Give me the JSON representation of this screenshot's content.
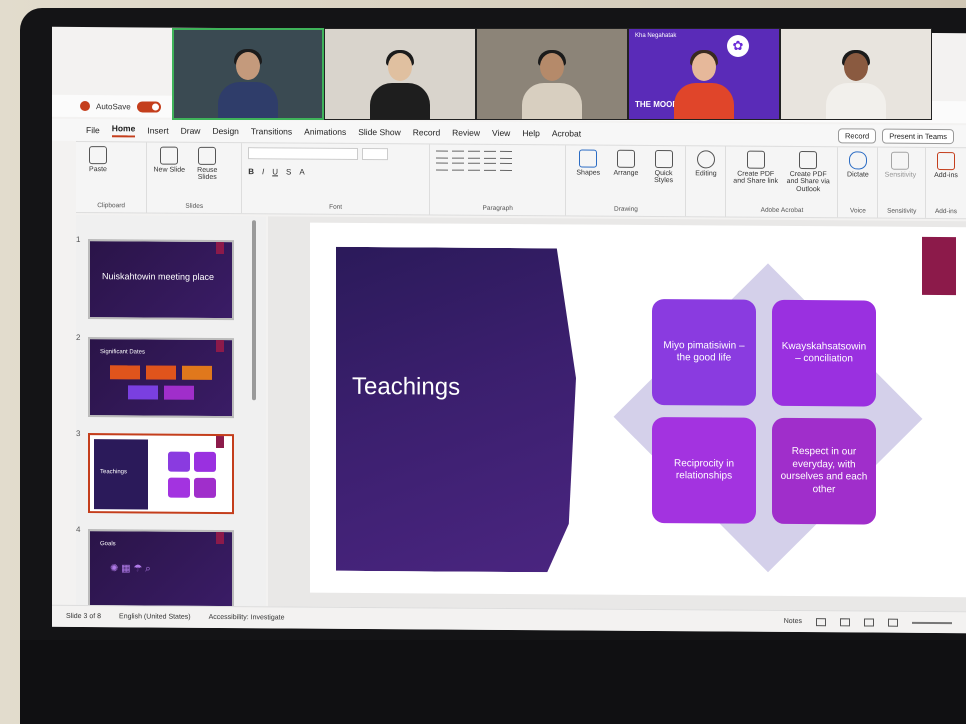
{
  "zoom": {
    "participant_name": "Kha Negahatak",
    "brand_tag": "THE MOODLE",
    "brand_logo_text": "MOODLE"
  },
  "titlebar": {
    "autosave_label": "AutoSave",
    "autosave_state": "On"
  },
  "tabs": [
    {
      "label": "File"
    },
    {
      "label": "Home"
    },
    {
      "label": "Insert"
    },
    {
      "label": "Draw"
    },
    {
      "label": "Design"
    },
    {
      "label": "Transitions"
    },
    {
      "label": "Animations"
    },
    {
      "label": "Slide Show"
    },
    {
      "label": "Record"
    },
    {
      "label": "Review"
    },
    {
      "label": "View"
    },
    {
      "label": "Help"
    },
    {
      "label": "Acrobat"
    }
  ],
  "tab_actions": {
    "record": "Record",
    "present": "Present in Teams"
  },
  "ribbon": {
    "paste": "Paste",
    "clipboard": "Clipboard",
    "new_slide": "New Slide",
    "reuse_slides": "Reuse Slides",
    "slides_group": "Slides",
    "font_group": "Font",
    "paragraph_group": "Paragraph",
    "shapes": "Shapes",
    "arrange": "Arrange",
    "quick_styles": "Quick Styles",
    "drawing_group": "Drawing",
    "editing": "Editing",
    "create_pdf_share": "Create PDF and Share link",
    "create_pdf_outlook": "Create PDF and Share via Outlook",
    "adobe_group": "Adobe Acrobat",
    "dictate": "Dictate",
    "voice_group": "Voice",
    "sensitivity": "Sensitivity",
    "sensitivity_group": "Sensitivity",
    "addins": "Add-ins",
    "addins_group": "Add-ins"
  },
  "thumbnails": [
    {
      "num": "1",
      "title": "Nuiskahtowin meeting place"
    },
    {
      "num": "2",
      "title": "Significant Dates"
    },
    {
      "num": "3",
      "title": "Teachings"
    },
    {
      "num": "4",
      "title": "Goals"
    }
  ],
  "slide": {
    "title": "Teachings",
    "boxes": [
      "Miyo pimatisiwin – the good life",
      "Kwayskahsatsowin – conciliation",
      "Reciprocity in relationships",
      "Respect in our everyday, with ourselves and each other"
    ]
  },
  "status": {
    "slide_count": "Slide 3 of 8",
    "language": "English (United States)",
    "accessibility": "Accessibility: Investigate",
    "notes": "Notes"
  },
  "colors": {
    "accent": "#c43e1c",
    "slide_dark": "#2b1a5a",
    "box_purple": "#8a3be0",
    "deco_rect": "#8c1a4a"
  }
}
